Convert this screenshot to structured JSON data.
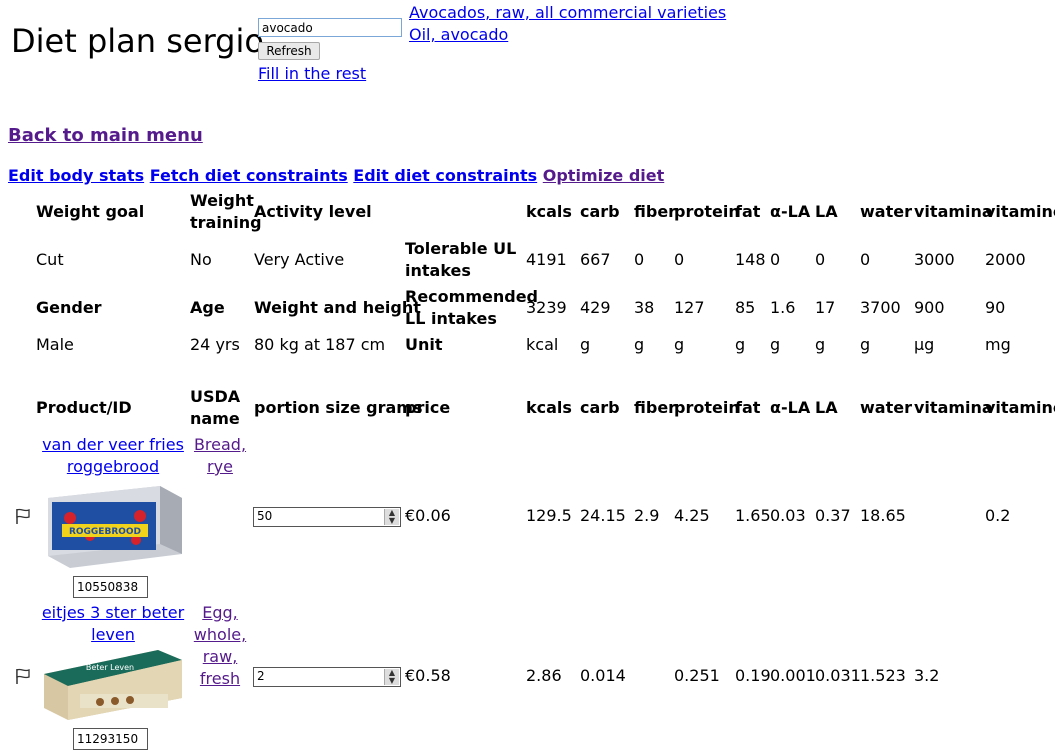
{
  "header": {
    "title": "Diet plan sergio",
    "search_value": "avocado",
    "refresh_label": "Refresh",
    "fill_rest_label": "Fill in the rest",
    "suggestions": [
      "Avocados, raw, all commercial varieties",
      "Oil, avocado"
    ]
  },
  "nav": {
    "back_label": "Back to main menu",
    "links": [
      "Edit body stats",
      "Fetch diet constraints",
      "Edit diet constraints",
      "Optimize diet"
    ]
  },
  "stats": {
    "headers": [
      "Weight goal",
      "Weight training",
      "Activity level"
    ],
    "values": [
      "Cut",
      "No",
      "Very Active"
    ],
    "headers2": [
      "Gender",
      "Age",
      "Weight and height"
    ],
    "values2": [
      "Male",
      "24 yrs",
      "80 kg at 187 cm"
    ]
  },
  "nutrient_columns": [
    "kcals",
    "carb",
    "fiber",
    "protein",
    "fat",
    "α-LA",
    "LA",
    "water",
    "vitamina",
    "vitaminc"
  ],
  "constraints": {
    "ul_label": "Tolerable UL intakes",
    "ul": [
      "4191",
      "667",
      "0",
      "0",
      "148",
      "0",
      "0",
      "0",
      "3000",
      "2000"
    ],
    "ll_label": "Recommended LL intakes",
    "ll": [
      "3239",
      "429",
      "38",
      "127",
      "85",
      "1.6",
      "17",
      "3700",
      "900",
      "90"
    ],
    "unit_label": "Unit",
    "unit": [
      "kcal",
      "g",
      "g",
      "g",
      "g",
      "g",
      "g",
      "g",
      "μg",
      "mg"
    ]
  },
  "products_header": {
    "product": "Product/ID",
    "usda": "USDA name",
    "portion": "portion size grams",
    "price": "price"
  },
  "products": [
    {
      "name": "van der veer fries roggebrood",
      "usda": "Bread, rye",
      "id": "10550838",
      "portion": "50",
      "price": "€0.06",
      "image_label": "ROGGEBROOD",
      "values": [
        "129.5",
        "24.15",
        "2.9",
        "4.25",
        "1.65",
        "0.03",
        "0.37",
        "18.65",
        "",
        "0.2"
      ]
    },
    {
      "name": "eitjes 3 ster beter leven",
      "usda": "Egg, whole, raw, fresh",
      "id": "11293150",
      "portion": "2",
      "price": "€0.58",
      "image_label": "Beter Leven",
      "values": [
        "2.86",
        "0.014",
        "",
        "0.251",
        "0.19",
        "0.001",
        "0.031",
        "1.523",
        "3.2",
        ""
      ]
    }
  ],
  "colors": {
    "link": "#0000ee",
    "visited": "#551a8b"
  }
}
